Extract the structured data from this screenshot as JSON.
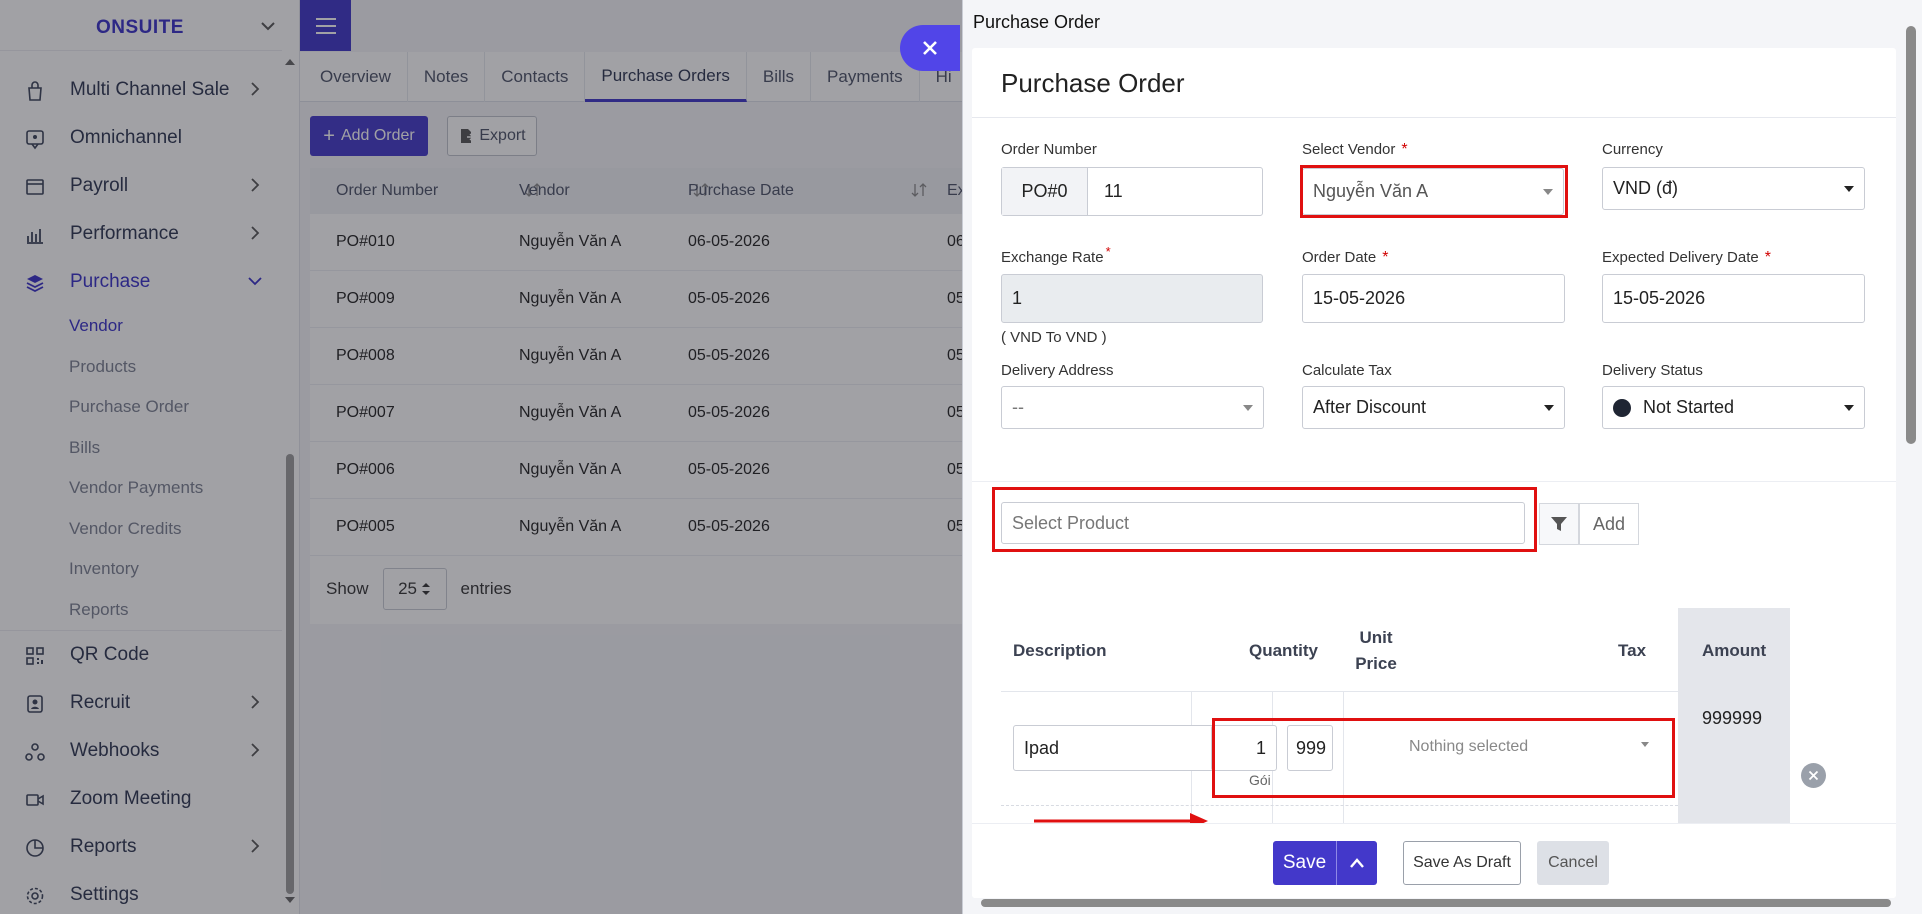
{
  "sidebar": {
    "brand": "ONSUITE",
    "items": [
      {
        "label": "Multi Channel Sale",
        "icon": "bag-icon",
        "arrow": true
      },
      {
        "label": "Omnichannel",
        "icon": "chat-icon",
        "arrow": false
      },
      {
        "label": "Payroll",
        "icon": "payroll-icon",
        "arrow": true
      },
      {
        "label": "Performance",
        "icon": "bar-chart-icon",
        "arrow": true
      },
      {
        "label": "Purchase",
        "icon": "layers-icon",
        "arrow": true
      }
    ],
    "purchase_sub": [
      "Vendor",
      "Products",
      "Purchase Order",
      "Bills",
      "Vendor Payments",
      "Vendor Credits",
      "Inventory",
      "Reports"
    ],
    "items_after": [
      {
        "label": "QR Code",
        "icon": "qr-code-icon",
        "arrow": false
      },
      {
        "label": "Recruit",
        "icon": "recruit-icon",
        "arrow": true
      },
      {
        "label": "Webhooks",
        "icon": "webhooks-icon",
        "arrow": true
      },
      {
        "label": "Zoom Meeting",
        "icon": "video-icon",
        "arrow": false
      },
      {
        "label": "Reports",
        "icon": "pie-chart-icon",
        "arrow": true
      },
      {
        "label": "Settings",
        "icon": "gear-icon",
        "arrow": false
      }
    ]
  },
  "vendor_tabs": [
    "Overview",
    "Notes",
    "Contacts",
    "Purchase Orders",
    "Bills",
    "Payments",
    "Hi"
  ],
  "toolbar": {
    "add_order": "Add Order",
    "export": "Export"
  },
  "orders_table": {
    "headers": [
      "Order Number",
      "Vendor",
      "Purchase Date",
      "Ex"
    ],
    "rows": [
      [
        "PO#010",
        "Nguyễn Văn A",
        "06-05-2026",
        "06"
      ],
      [
        "PO#009",
        "Nguyễn Văn A",
        "05-05-2026",
        "05"
      ],
      [
        "PO#008",
        "Nguyễn Văn A",
        "05-05-2026",
        "05"
      ],
      [
        "PO#007",
        "Nguyễn Văn A",
        "05-05-2026",
        "05"
      ],
      [
        "PO#006",
        "Nguyễn Văn A",
        "05-05-2026",
        "05"
      ],
      [
        "PO#005",
        "Nguyễn Văn A",
        "05-05-2026",
        "05"
      ]
    ],
    "show_label": "Show",
    "page_size": "25",
    "entries_label": "entries"
  },
  "drawer": {
    "title": "Purchase Order",
    "card_title": "Purchase Order",
    "order_number_label": "Order Number",
    "order_prefix": "PO#0",
    "order_number": "11",
    "vendor_label": "Select Vendor",
    "vendor_value": "Nguyễn Văn A",
    "currency_label": "Currency",
    "currency_value": "VND (đ)",
    "exchange_rate_label": "Exchange Rate",
    "exchange_rate_value": "1",
    "exchange_note": "( VND To VND )",
    "order_date_label": "Order Date",
    "order_date_value": "15-05-2026",
    "expected_date_label": "Expected Delivery Date",
    "expected_date_value": "15-05-2026",
    "delivery_address_label": "Delivery Address",
    "delivery_address_value": "--",
    "calc_tax_label": "Calculate Tax",
    "calc_tax_value": "After Discount",
    "delivery_status_label": "Delivery Status",
    "delivery_status_value": "Not Started",
    "select_product_placeholder": "Select Product",
    "add_label": "Add",
    "required_mark": "*",
    "items_table": {
      "headers": {
        "description": "Description",
        "quantity": "Quantity",
        "unit_price_1": "Unit",
        "unit_price_2": "Price",
        "tax": "Tax",
        "amount": "Amount"
      },
      "row": {
        "description": "Ipad",
        "quantity": "1",
        "unit": "Gói",
        "unit_price": "999",
        "tax_placeholder": "Nothing selected",
        "amount": "999999"
      }
    },
    "buttons": {
      "save": "Save",
      "save_draft": "Save As Draft",
      "cancel": "Cancel"
    }
  },
  "colors": {
    "accent": "#4338ca",
    "highlight": "#e01010"
  }
}
